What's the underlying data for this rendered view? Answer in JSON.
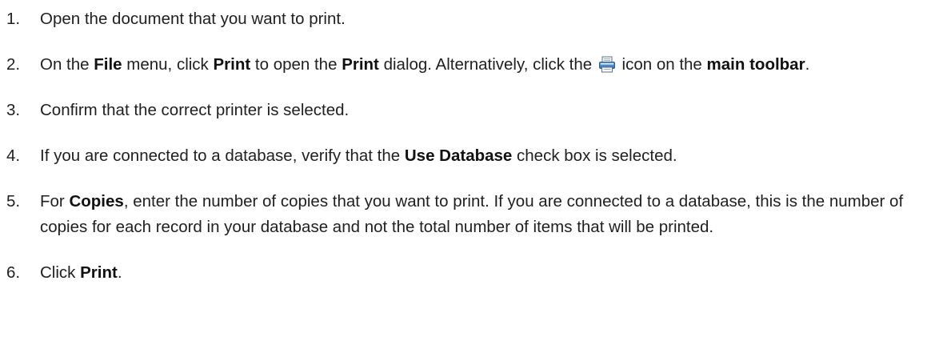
{
  "steps": [
    {
      "number": "1.",
      "parts": {
        "p0": "Open the document that you want to print."
      }
    },
    {
      "number": "2.",
      "parts": {
        "p0": "On the ",
        "file": "File",
        "p1": " menu, click ",
        "print": "Print",
        "p2": " to open the ",
        "print_dialog": "Print",
        "p3": " dialog. Alternatively, click the ",
        "p4": " icon on the ",
        "main_toolbar": "main toolbar",
        "p5": "."
      },
      "icon": "printer-icon"
    },
    {
      "number": "3.",
      "parts": {
        "p0": "Confirm that the correct printer is selected."
      }
    },
    {
      "number": "4.",
      "parts": {
        "p0": "If you are connected to a database, verify that the ",
        "use_database": "Use Database",
        "p1": " check box is selected."
      }
    },
    {
      "number": "5.",
      "parts": {
        "p0": "For ",
        "copies": "Copies",
        "p1": ", enter the number of copies that you want to print. If you are connected to a database, this is the number of copies for each record in your database and not the total number of items that will be printed."
      }
    },
    {
      "number": "6.",
      "parts": {
        "p0": "Click ",
        "print": "Print",
        "p1": "."
      }
    }
  ]
}
